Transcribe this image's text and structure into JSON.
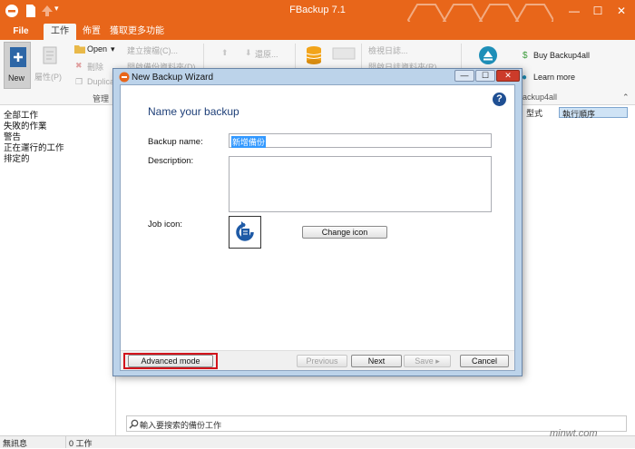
{
  "app": {
    "title": "FBackup 7.1",
    "accent_color": "#e8661a"
  },
  "menu_tabs": [
    {
      "label": "File"
    },
    {
      "label": "工作"
    },
    {
      "label": "佈置"
    },
    {
      "label": "獲取更多功能"
    }
  ],
  "ribbon": {
    "new_label": "New",
    "properties_label": "屬性(P)",
    "open_label": "Open",
    "delete_label": "刪除",
    "duplicate_label": "Duplica",
    "manage_label": "管理",
    "create_catalog_label": "建立搜檔(C)...",
    "open_backup_folder_label": "開啟備份資料夾(D)",
    "restore_label": "還原...",
    "view_log_label": "檢視日誌...",
    "open_log_folder_label": "開啟日誌資料夾(R)",
    "buy_label": "Buy Backup4all",
    "learn_label": "Learn more",
    "group_label": "Backup4all"
  },
  "left_panel": {
    "items": [
      {
        "label": "全部工作"
      },
      {
        "label": "失敗的作業"
      },
      {
        "label": "警告"
      },
      {
        "label": "正在運行的工作"
      },
      {
        "label": "排定的"
      }
    ]
  },
  "columns": {
    "type_label": "型式",
    "order_label": "執行順序"
  },
  "dialog": {
    "title": "New Backup Wizard",
    "heading": "Name your backup",
    "backup_name_label": "Backup name:",
    "backup_name_value": "新增備份",
    "description_label": "Description:",
    "description_value": "",
    "job_icon_label": "Job icon:",
    "change_icon_label": "Change icon",
    "advanced_mode_label": "Advanced mode",
    "previous_label": "Previous",
    "next_label": "Next",
    "save_label": "Save",
    "cancel_label": "Cancel"
  },
  "search": {
    "placeholder": "輸入要搜索的備份工作"
  },
  "status": {
    "message": "無訊息",
    "job_count": "0 工作"
  },
  "watermark": {
    "text": "minwt.com"
  }
}
